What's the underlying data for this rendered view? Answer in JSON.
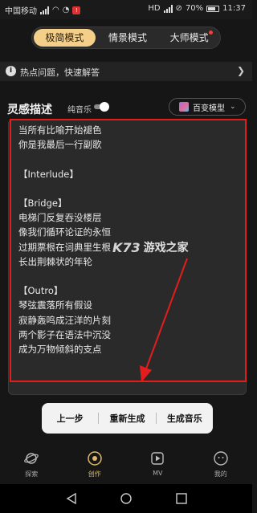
{
  "status_bar": {
    "carrier": "中国移动",
    "network": "HD",
    "battery": "70%",
    "time": "11:37"
  },
  "mode_tabs": [
    {
      "label": "极简模式",
      "active": true
    },
    {
      "label": "情景模式",
      "active": false
    },
    {
      "label": "大师模式",
      "active": false,
      "dot": true
    }
  ],
  "hot_bar": {
    "icon": "info-icon",
    "text": "热点问题，快速解答"
  },
  "inspiration": {
    "title": "灵感描述",
    "pure_music_label": "纯音乐",
    "pure_music_on": false,
    "model_label": "百变模型"
  },
  "lyrics": {
    "text": "当所有比喻开始褪色\n你是我最后一行副歌\n\n【Interlude】\n\n【Bridge】\n电梯门反复吞没楼层\n像我们循环论证的永恒\n过期票根在词典里生根\n长出荆棘状的年轮\n\n【Outro】\n琴弦震落所有假设\n寂静轰鸣成汪洋的片刻\n两个影子在语法中沉没\n成为万物倾斜的支点"
  },
  "watermark": {
    "logo": "K73",
    "text": "游戏之家"
  },
  "actions": {
    "prev": "上一步",
    "regenerate": "重新生成",
    "generate": "生成音乐"
  },
  "bottom_nav": [
    {
      "label": "探索",
      "icon": "planet-icon",
      "active": false
    },
    {
      "label": "创作",
      "icon": "disc-icon",
      "active": true
    },
    {
      "label": "MV",
      "icon": "play-icon",
      "active": false
    },
    {
      "label": "我的",
      "icon": "face-icon",
      "active": false
    }
  ],
  "colors": {
    "accent": "#f3cf8a",
    "annotation_red": "#e31d1d",
    "background": "#161616"
  }
}
